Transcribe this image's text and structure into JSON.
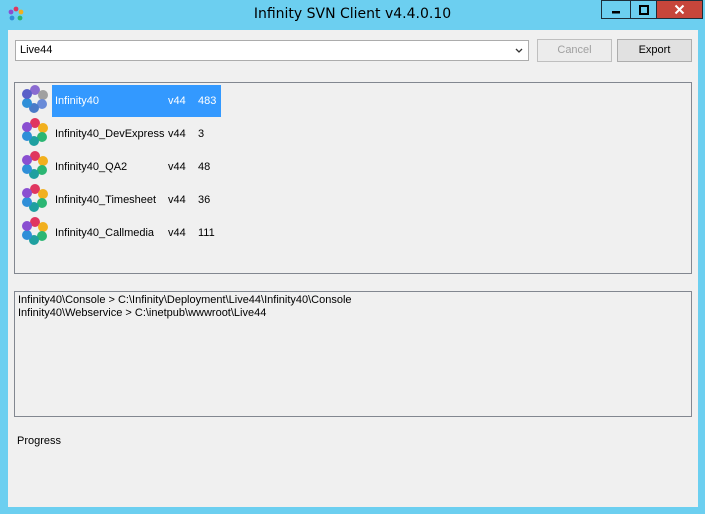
{
  "window": {
    "title": "Infinity SVN Client v4.4.0.10",
    "close_color": "#c7463b",
    "frame_color": "#6ccff0"
  },
  "toolbar": {
    "branch_select": {
      "value": "Live44"
    },
    "cancel_label": "Cancel",
    "export_label": "Export"
  },
  "projects": [
    {
      "name": "Infinity40",
      "version": "v44",
      "revision": "483",
      "selected": true
    },
    {
      "name": "Infinity40_DevExpress",
      "version": "v44",
      "revision": "3",
      "selected": false
    },
    {
      "name": "Infinity40_QA2",
      "version": "v44",
      "revision": "48",
      "selected": false
    },
    {
      "name": "Infinity40_Timesheet",
      "version": "v44",
      "revision": "36",
      "selected": false
    },
    {
      "name": "Infinity40_Callmedia",
      "version": "v44",
      "revision": "111",
      "selected": false
    }
  ],
  "log": [
    "Infinity40\\Console > C:\\Infinity\\Deployment\\Live44\\Infinity40\\Console",
    "Infinity40\\Webservice > C:\\inetpub\\wwwroot\\Live44"
  ],
  "status": {
    "progress_label": "Progress"
  },
  "icons": {
    "app": "app-icon",
    "project": "project-cube-icon",
    "dropdown": "chevron-down-icon",
    "minimize": "minimize-icon",
    "maximize": "maximize-icon",
    "close": "close-icon"
  }
}
